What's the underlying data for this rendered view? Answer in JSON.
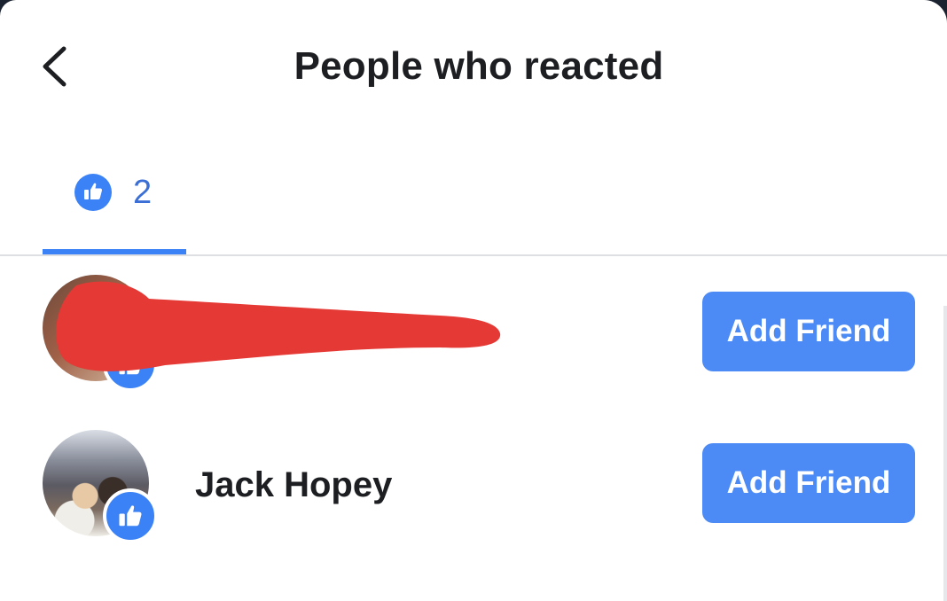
{
  "header": {
    "title": "People who reacted",
    "back_icon": "chevron-left-icon"
  },
  "tabs": [
    {
      "icon": "thumbs-up-icon",
      "count": "2",
      "selected": true
    }
  ],
  "people": [
    {
      "name": "",
      "redacted": true,
      "reaction_icon": "thumbs-up-icon",
      "action_label": "Add Friend"
    },
    {
      "name": "Jack Hopey",
      "redacted": false,
      "reaction_icon": "thumbs-up-icon",
      "action_label": "Add Friend"
    }
  ],
  "colors": {
    "accent": "#3b82f6",
    "button": "#4c8bf5",
    "redaction": "#e53935",
    "text": "#1c1e21"
  }
}
